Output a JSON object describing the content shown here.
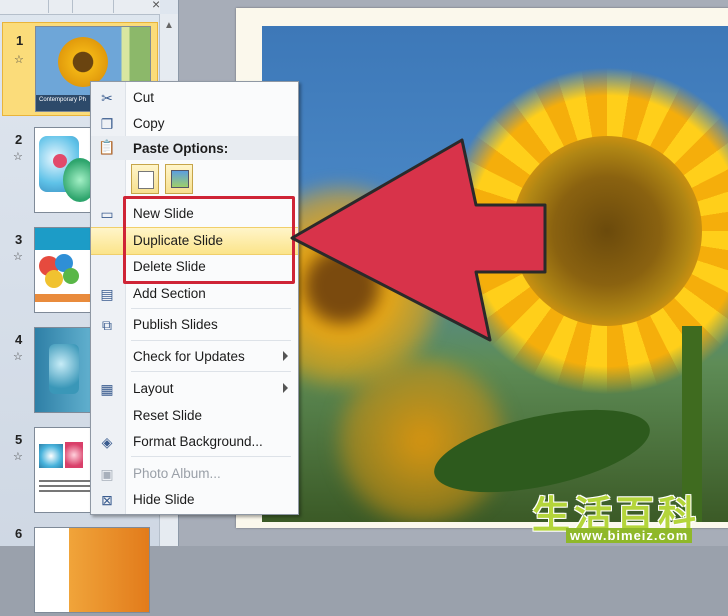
{
  "thumbnails": [
    {
      "number": "1",
      "caption": "Contemporary Ph"
    },
    {
      "number": "2"
    },
    {
      "number": "3"
    },
    {
      "number": "4"
    },
    {
      "number": "5"
    },
    {
      "number": "6"
    }
  ],
  "context_menu": {
    "cut": "Cut",
    "copy": "Copy",
    "paste_options": "Paste Options:",
    "new_slide": "New Slide",
    "duplicate_slide": "Duplicate Slide",
    "delete_slide": "Delete Slide",
    "add_section": "Add Section",
    "publish_slides": "Publish Slides",
    "check_for_updates": "Check for Updates",
    "layout": "Layout",
    "reset_slide": "Reset Slide",
    "format_background": "Format Background...",
    "photo_album": "Photo Album...",
    "hide_slide": "Hide Slide"
  },
  "annotation": {
    "color": "#cf2436"
  },
  "watermark": {
    "text": "生活百科",
    "url": "www.bimeiz.com"
  }
}
